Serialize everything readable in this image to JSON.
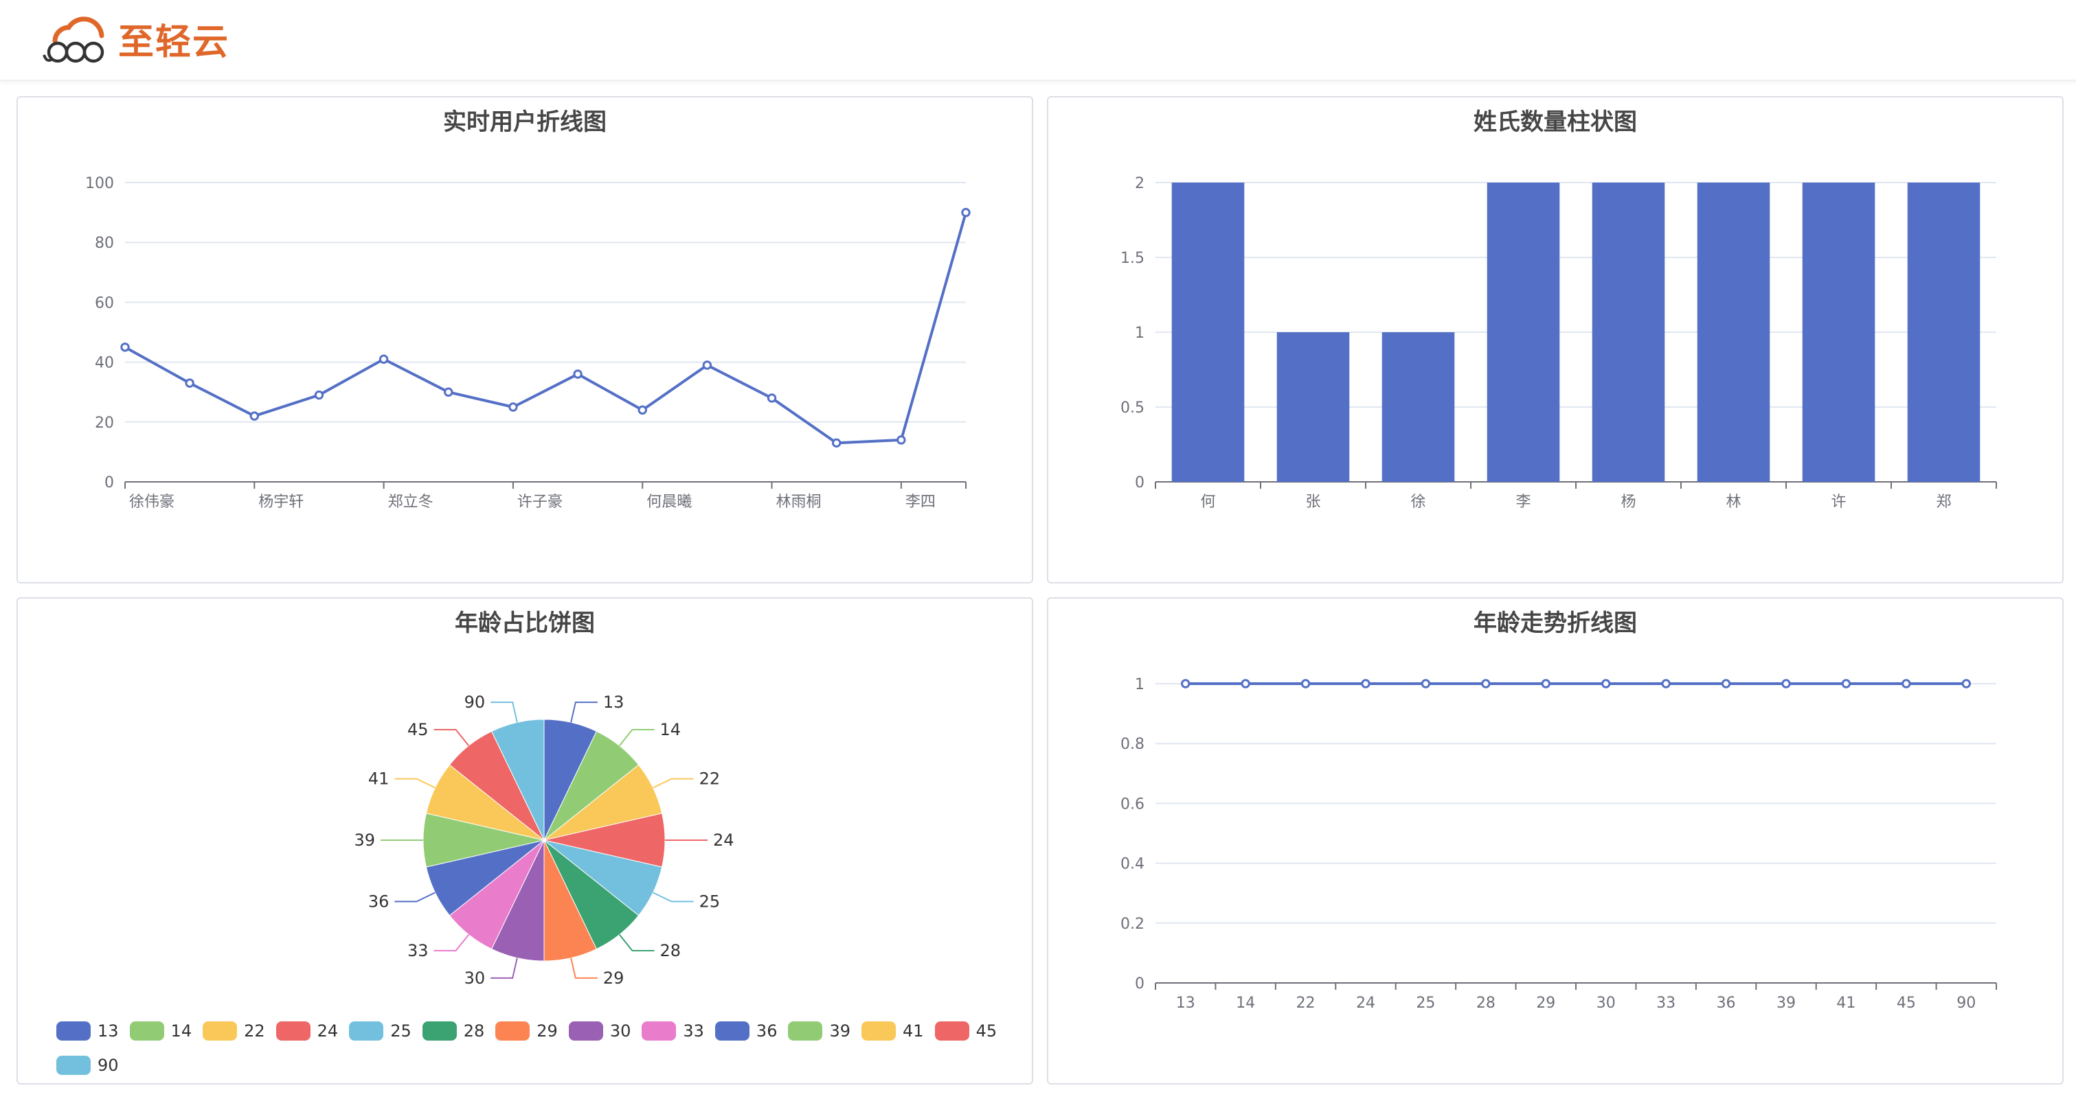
{
  "app": {
    "brand": "至轻云"
  },
  "palette": [
    "#5470c6",
    "#91cc75",
    "#fac858",
    "#ee6666",
    "#73c0de",
    "#3ba272",
    "#fc8452",
    "#9a60b4",
    "#ea7ccc"
  ],
  "chart_data": [
    {
      "id": "realtime-users",
      "type": "line",
      "title": "实时用户折线图",
      "tick_labels": [
        "徐伟豪",
        "杨宇轩",
        "郑立冬",
        "许子豪",
        "何晨曦",
        "林雨桐",
        "李四"
      ],
      "x_count": 14,
      "values": [
        45,
        33,
        22,
        29,
        41,
        30,
        25,
        36,
        24,
        39,
        28,
        13,
        14,
        90
      ],
      "ylim": [
        0,
        100
      ],
      "yticks": [
        0,
        20,
        40,
        60,
        80,
        100
      ],
      "grid": "horizontal"
    },
    {
      "id": "surname-count",
      "type": "bar",
      "title": "姓氏数量柱状图",
      "categories": [
        "何",
        "张",
        "徐",
        "李",
        "杨",
        "林",
        "许",
        "郑"
      ],
      "values": [
        2,
        1,
        1,
        2,
        2,
        2,
        2,
        2
      ],
      "ylim": [
        0,
        2
      ],
      "yticks": [
        "0",
        "0.5",
        "1",
        "1.5",
        "2"
      ],
      "grid": "horizontal"
    },
    {
      "id": "age-ratio",
      "type": "pie",
      "title": "年龄占比饼图",
      "labels": [
        "13",
        "14",
        "22",
        "24",
        "25",
        "28",
        "29",
        "30",
        "33",
        "36",
        "39",
        "41",
        "45",
        "90"
      ],
      "values": [
        1,
        1,
        1,
        1,
        1,
        1,
        1,
        1,
        1,
        1,
        1,
        1,
        1,
        1
      ],
      "legend": "bottom"
    },
    {
      "id": "age-trend",
      "type": "line",
      "title": "年龄走势折线图",
      "categories": [
        "13",
        "14",
        "22",
        "24",
        "25",
        "28",
        "29",
        "30",
        "33",
        "36",
        "39",
        "41",
        "45",
        "90"
      ],
      "values": [
        1,
        1,
        1,
        1,
        1,
        1,
        1,
        1,
        1,
        1,
        1,
        1,
        1,
        1
      ],
      "ylim": [
        0,
        1
      ],
      "yticks": [
        "0",
        "0.2",
        "0.4",
        "0.6",
        "0.8",
        "1"
      ],
      "grid": "horizontal"
    }
  ]
}
